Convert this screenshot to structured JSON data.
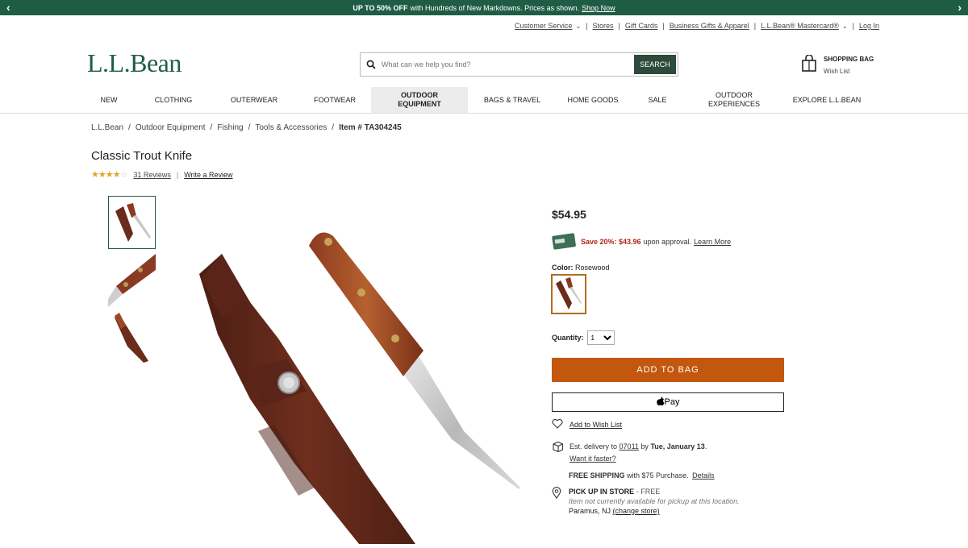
{
  "promo": {
    "bold": "UP TO 50% OFF",
    "message": "with Hundreds of New Markdowns. Prices as shown.",
    "link": "Shop Now"
  },
  "utility": {
    "customer_service": "Customer Service",
    "stores": "Stores",
    "gift_cards": "Gift Cards",
    "business": "Business Gifts & Apparel",
    "mastercard": "L.L.Bean® Mastercard®",
    "login": "Log In"
  },
  "logo": "L.L.Bean",
  "search": {
    "placeholder": "What can we help you find?",
    "button": "SEARCH"
  },
  "bag": {
    "title": "SHOPPING BAG",
    "wish_list": "Wish List"
  },
  "nav": {
    "items": [
      {
        "label": "NEW"
      },
      {
        "label": "CLOTHING"
      },
      {
        "label": "OUTERWEAR"
      },
      {
        "label": "FOOTWEAR"
      },
      {
        "label": "OUTDOOR EQUIPMENT"
      },
      {
        "label": "BAGS & TRAVEL"
      },
      {
        "label": "HOME GOODS"
      },
      {
        "label": "SALE"
      },
      {
        "label": "OUTDOOR EXPERIENCES"
      },
      {
        "label": "EXPLORE L.L.BEAN"
      }
    ]
  },
  "breadcrumb": {
    "items": [
      "L.L.Bean",
      "Outdoor Equipment",
      "Fishing",
      "Tools & Accessories"
    ],
    "item_number": "Item # TA304245"
  },
  "product": {
    "title": "Classic Trout Knife",
    "rating": 4.5,
    "reviews": "31 Reviews",
    "write_review": "Write a Review",
    "price": "$54.95",
    "save_text": "Save 20%: $43.96",
    "upon_text": "upon approval.",
    "learn_more": "Learn More",
    "color_label": "Color:",
    "color_value": "Rosewood",
    "quantity_label": "Quantity:",
    "quantity_value": "1",
    "add_to_bag": "ADD TO BAG",
    "apple_pay": "Pay",
    "add_wish": "Add to Wish List",
    "delivery_prefix": "Est. delivery to",
    "zip": "07011",
    "delivery_by": "by",
    "delivery_date": "Tue, January 13",
    "faster": "Want it faster?",
    "free_shipping": "FREE SHIPPING",
    "free_shipping_rest": "with $75 Purchase.",
    "details": "Details",
    "pickup_title": "PICK UP IN STORE",
    "pickup_free": "- FREE",
    "pickup_na": "Item not currently available for pickup at this location.",
    "store": "Paramus, NJ",
    "change_store": "(change store)"
  },
  "colors": {
    "brand_green": "#1f5c46",
    "add_to_bag": "#c3570d",
    "save_red": "#b32317",
    "star": "#e2a623"
  }
}
